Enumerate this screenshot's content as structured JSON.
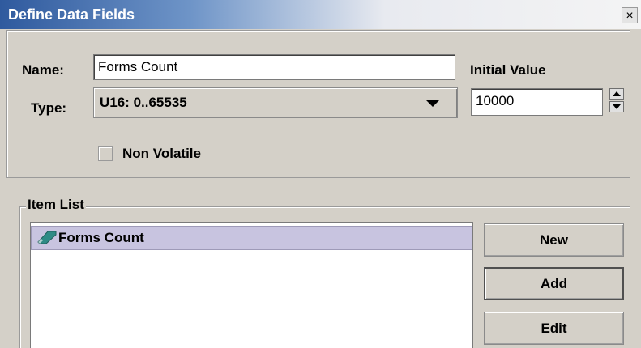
{
  "window": {
    "title": "Define Data Fields",
    "close_glyph": "×"
  },
  "form": {
    "name_label": "Name:",
    "name_value": "Forms Count",
    "type_label": "Type:",
    "type_value": "U16: 0..65535",
    "initial_value_label": "Initial Value",
    "initial_value": "10000",
    "non_volatile_label": "Non Volatile",
    "non_volatile_checked": false
  },
  "item_list": {
    "legend": "Item List",
    "items": [
      {
        "label": "Forms Count",
        "icon": "tag-icon",
        "selected": true
      }
    ]
  },
  "buttons": {
    "new_label": "New",
    "add_label": "Add",
    "edit_label": "Edit"
  },
  "colors": {
    "title_gradient_start": "#2f5a9e",
    "selection": "#c8c4e0",
    "tag_icon": "#2e8b86"
  }
}
